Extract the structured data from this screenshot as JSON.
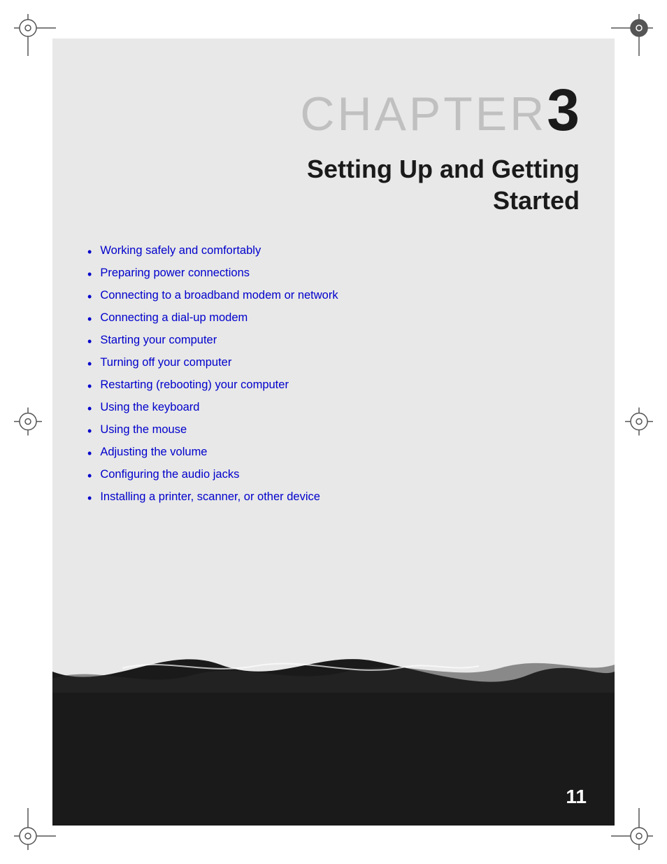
{
  "page": {
    "background": "#ffffff",
    "page_number": "11"
  },
  "chapter": {
    "label": "CHAPTER",
    "number": "3",
    "title_line1": "Setting Up and Getting",
    "title_line2": "Started"
  },
  "bullet_items": [
    {
      "id": 1,
      "text": "Working safely and comfortably"
    },
    {
      "id": 2,
      "text": "Preparing power connections"
    },
    {
      "id": 3,
      "text": "Connecting to a broadband modem or network"
    },
    {
      "id": 4,
      "text": "Connecting a dial-up modem"
    },
    {
      "id": 5,
      "text": "Starting your computer"
    },
    {
      "id": 6,
      "text": "Turning off your computer"
    },
    {
      "id": 7,
      "text": "Restarting (rebooting) your computer"
    },
    {
      "id": 8,
      "text": "Using the keyboard"
    },
    {
      "id": 9,
      "text": "Using the mouse"
    },
    {
      "id": 10,
      "text": "Adjusting the volume"
    },
    {
      "id": 11,
      "text": "Configuring the audio jacks"
    },
    {
      "id": 12,
      "text": "Installing a printer, scanner, or other device"
    }
  ]
}
